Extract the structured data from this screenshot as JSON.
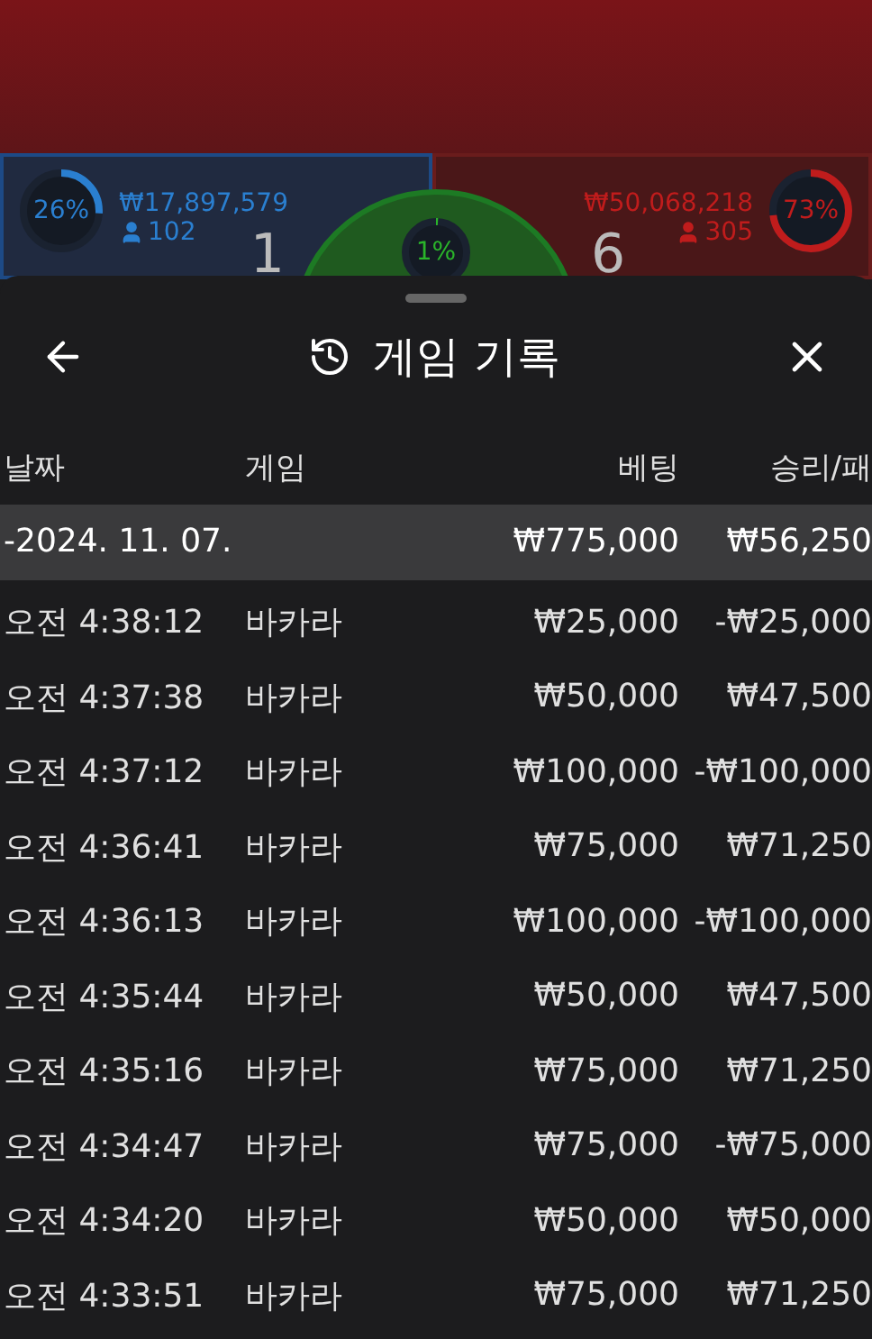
{
  "player": {
    "percent": "26%",
    "amount": "₩17,897,579",
    "bettors": "102",
    "score": "1"
  },
  "tie": {
    "percent": "1%"
  },
  "banker": {
    "percent": "73%",
    "amount": "₩50,068,218",
    "bettors": "305",
    "score": "6"
  },
  "sheet": {
    "title": "게임 기록"
  },
  "table": {
    "columns": [
      "날짜",
      "게임",
      "베팅",
      "승리/패"
    ],
    "summary": {
      "date": "-2024. 11. 07.",
      "bet": "₩775,000",
      "result": "₩56,250"
    },
    "rows": [
      {
        "time": "오전 4:38:12",
        "game": "바카라",
        "bet": "₩25,000",
        "result": "-₩25,000"
      },
      {
        "time": "오전 4:37:38",
        "game": "바카라",
        "bet": "₩50,000",
        "result": "₩47,500"
      },
      {
        "time": "오전 4:37:12",
        "game": "바카라",
        "bet": "₩100,000",
        "result": "-₩100,000"
      },
      {
        "time": "오전 4:36:41",
        "game": "바카라",
        "bet": "₩75,000",
        "result": "₩71,250"
      },
      {
        "time": "오전 4:36:13",
        "game": "바카라",
        "bet": "₩100,000",
        "result": "-₩100,000"
      },
      {
        "time": "오전 4:35:44",
        "game": "바카라",
        "bet": "₩50,000",
        "result": "₩47,500"
      },
      {
        "time": "오전 4:35:16",
        "game": "바카라",
        "bet": "₩75,000",
        "result": "₩71,250"
      },
      {
        "time": "오전 4:34:47",
        "game": "바카라",
        "bet": "₩75,000",
        "result": "-₩75,000"
      },
      {
        "time": "오전 4:34:20",
        "game": "바카라",
        "bet": "₩50,000",
        "result": "₩50,000"
      },
      {
        "time": "오전 4:33:51",
        "game": "바카라",
        "bet": "₩75,000",
        "result": "₩71,250"
      }
    ]
  }
}
